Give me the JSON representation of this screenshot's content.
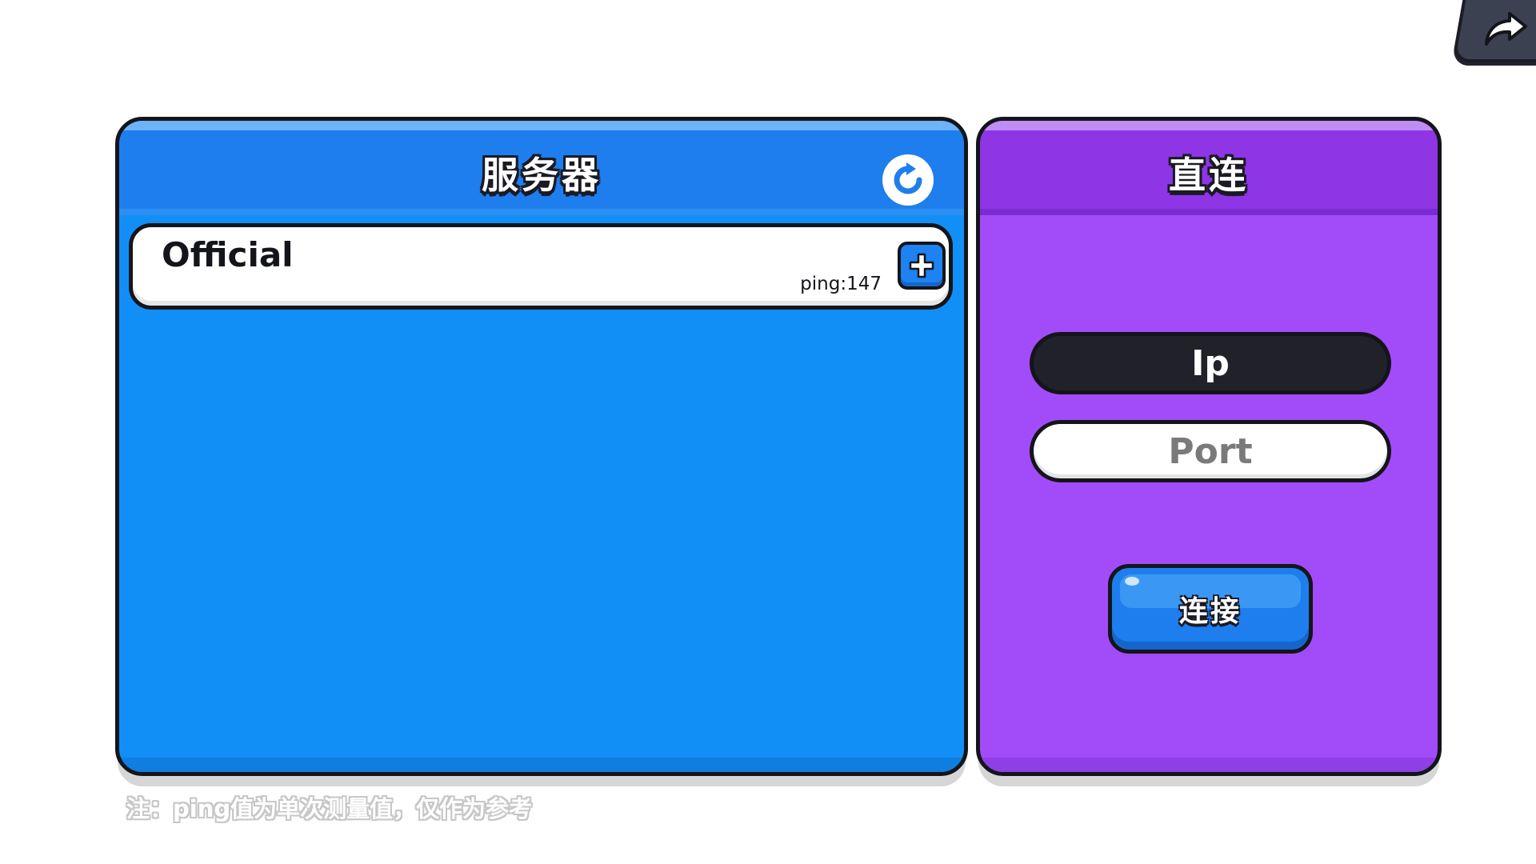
{
  "top_bar": {
    "back_icon": "share-arrow-icon"
  },
  "server_panel": {
    "title": "服务器",
    "refresh_icon": "refresh-icon",
    "color": "#118ff6",
    "servers": [
      {
        "name": "Official",
        "ping": "ping:147",
        "action_icon": "plus-icon"
      }
    ]
  },
  "direct_panel": {
    "title": "直连",
    "color": "#a24cf9",
    "ip_placeholder": "Ip",
    "ip_value": "",
    "port_placeholder": "Port",
    "port_value": "",
    "connect_label": "连接"
  },
  "footnote": "注：ping值为单次测量值，仅作为参考"
}
